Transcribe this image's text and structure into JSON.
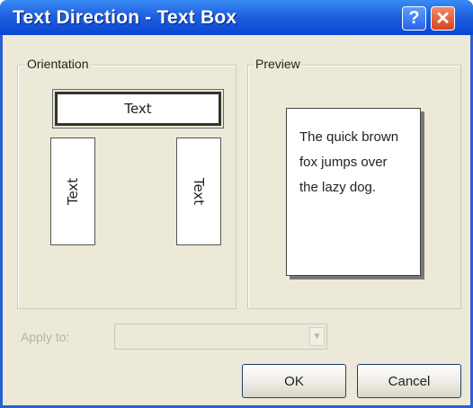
{
  "window": {
    "title": "Text Direction - Text Box"
  },
  "titlebar": {
    "help_label": "?",
    "close_label": "✕"
  },
  "orientation": {
    "label": "Orientation",
    "options": {
      "horizontal": "Text",
      "vertical_up": "Text",
      "vertical_down": "Text"
    },
    "selected": "horizontal"
  },
  "preview": {
    "label": "Preview",
    "lines": [
      "The quick brown",
      "fox jumps over",
      "the lazy dog."
    ]
  },
  "apply_to": {
    "label": "Apply to:",
    "value": ""
  },
  "buttons": {
    "ok": "OK",
    "cancel": "Cancel"
  }
}
